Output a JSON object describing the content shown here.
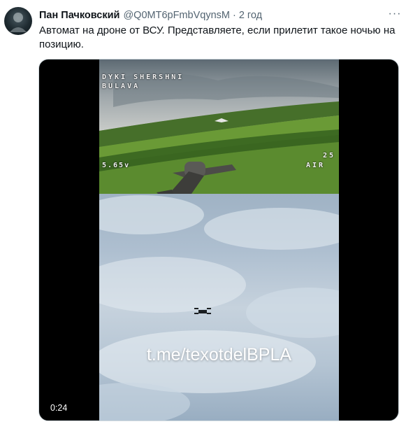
{
  "tweet": {
    "author": {
      "display_name": "Пан Пачковский",
      "handle": "@Q0MT6pFmbVqynsM",
      "avatar_icon": "avatar-image"
    },
    "separator": "·",
    "time": "2 год",
    "more_icon": "more-horizontal-icon",
    "more_glyph": "···",
    "text": "Автомат на дроне от ВСУ. Представляете, если прилетит такое ночью на позицию."
  },
  "media": {
    "type": "video",
    "duration": "0:24",
    "osd": {
      "line1": "DYKI SHERSHNI",
      "line2": "BULAVA",
      "voltage": "5.65v",
      "right_value": "25",
      "air": "AIR"
    },
    "watermark": "t.me/texotdelBPLA"
  },
  "colors": {
    "text_primary": "#0f1419",
    "text_secondary": "#536471",
    "border": "#cfd9de"
  }
}
